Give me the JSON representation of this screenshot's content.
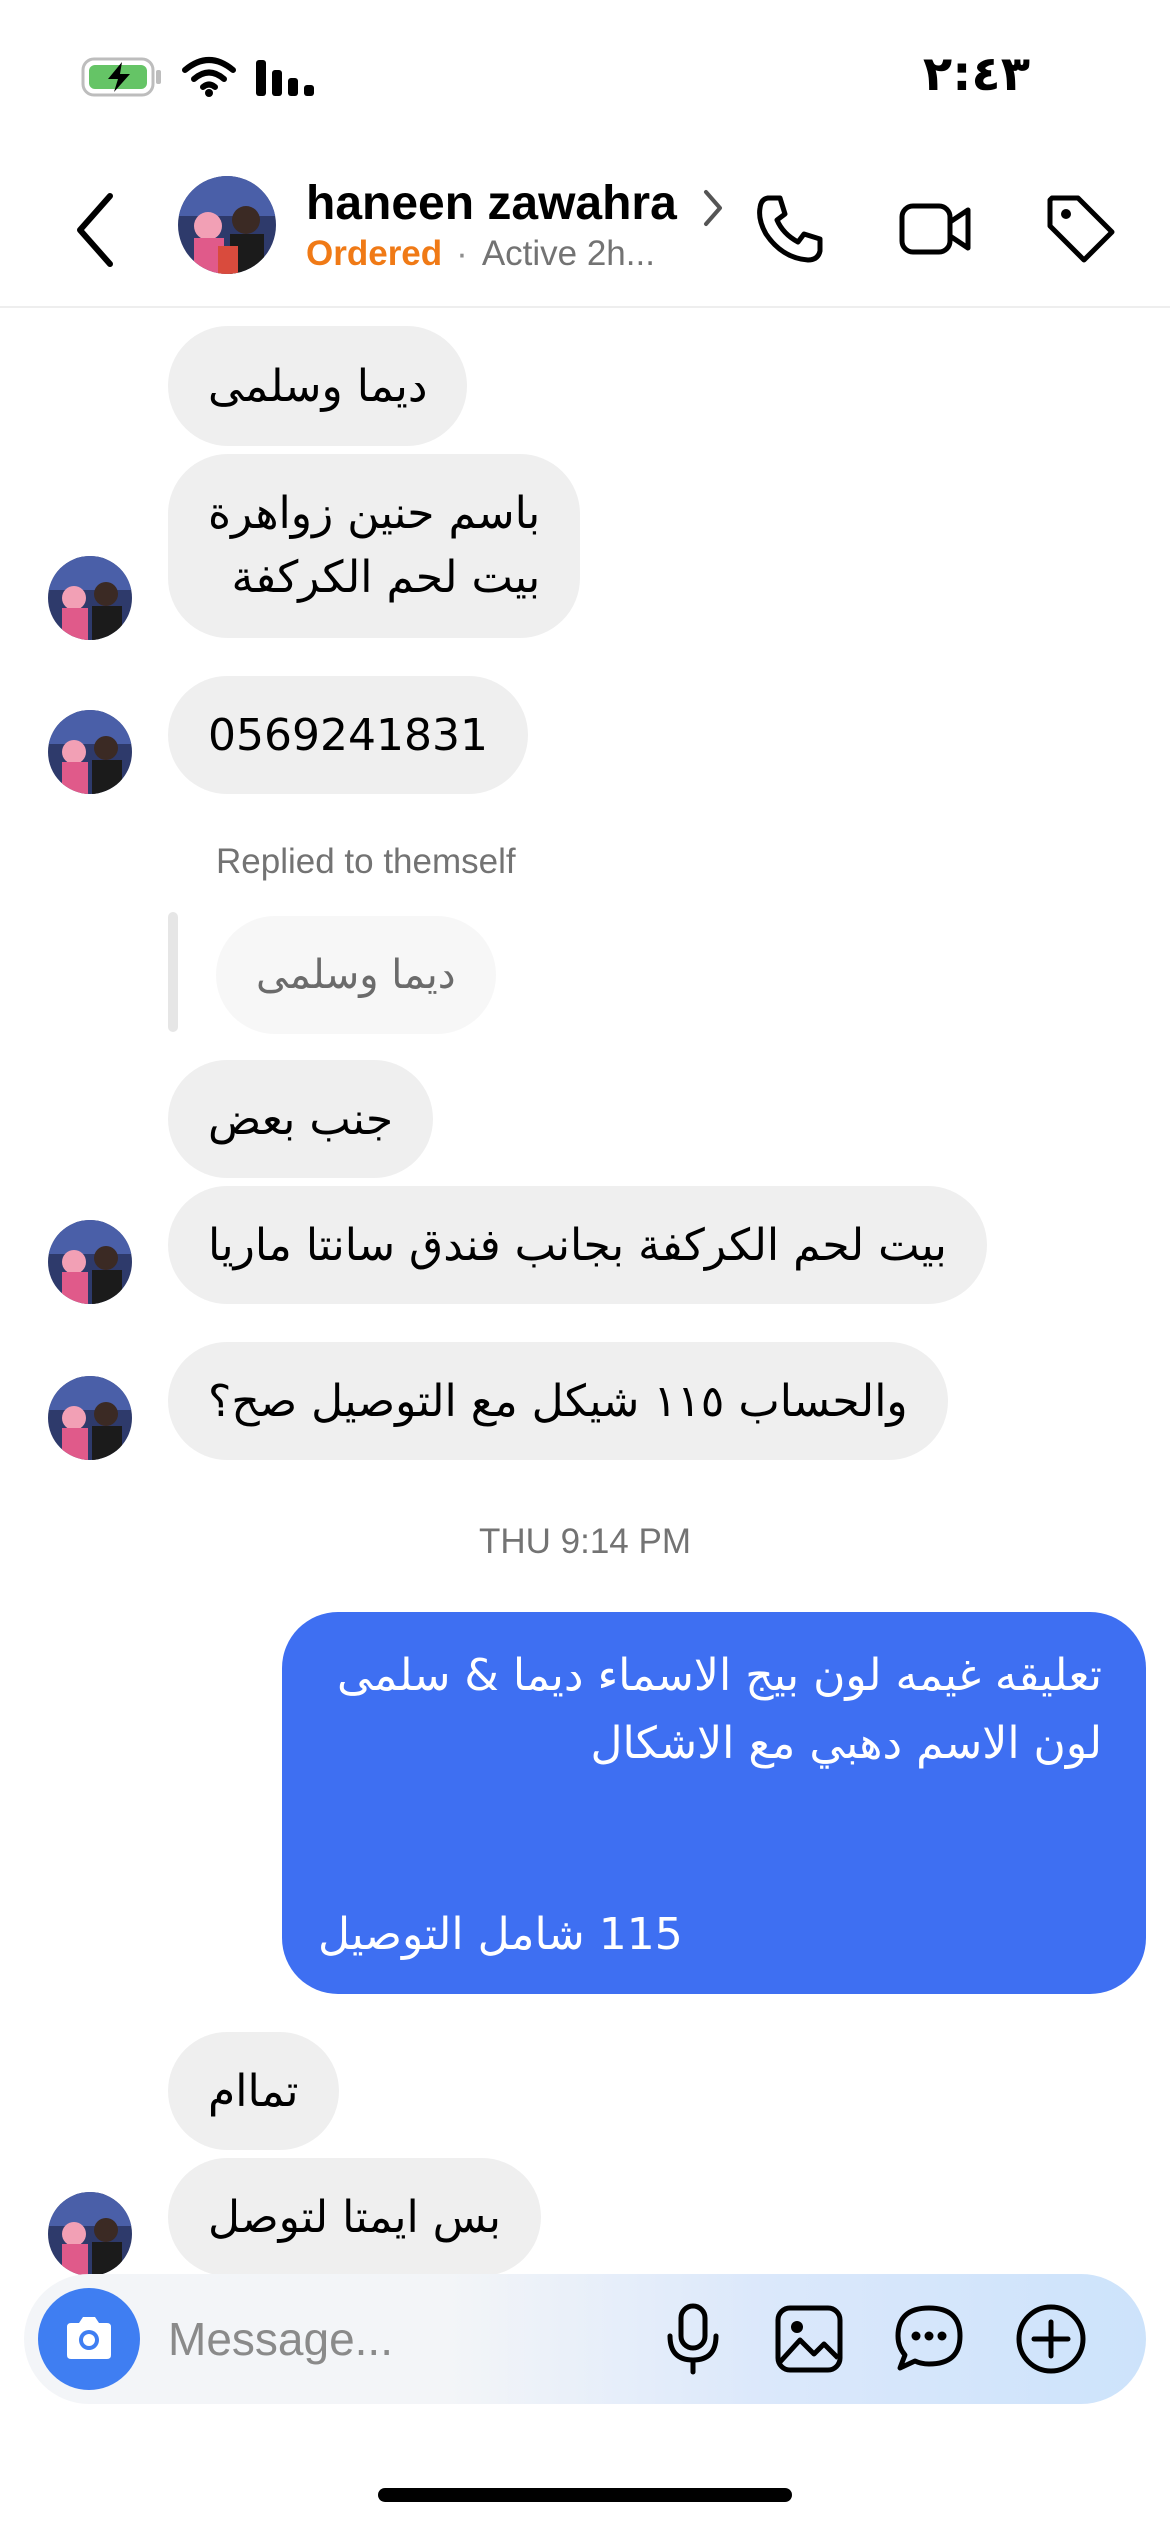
{
  "status_bar": {
    "time": "٢:٤٣"
  },
  "header": {
    "contact_name": "haneen zawahra",
    "status_label": "Ordered",
    "separator": "·",
    "activity": "Active 2h..."
  },
  "messages": {
    "m1": "ديما   وسلمى",
    "m2_line1": "باسم حنين زواهرة",
    "m2_line2": "بيت لحم الكركفة",
    "m3": "0569241831",
    "reply_note": "Replied to themself",
    "reply_quote": "ديما   وسلمى",
    "m4": "جنب بعض",
    "m5": "بيت لحم الكركفة بجانب فندق سانتا ماريا",
    "m6": "والحساب ١١٥ شيكل مع التوصيل صح؟",
    "timestamp": "THU 9:14 PM",
    "sent_line1": "تعليقه غيمه لون بيج الاسماء ديما & سلمى",
    "sent_line2": "لون الاسم دهبي مع الاشكال",
    "sent_line3": "115 شامل التوصيل",
    "m7": "تماام",
    "m8": "بس ايمتا لتوصل"
  },
  "composer": {
    "placeholder": "Message..."
  },
  "icons": {
    "back": "chevron-left-icon",
    "phone": "phone-icon",
    "video": "video-camera-icon",
    "tag": "tag-icon",
    "camera": "camera-icon",
    "mic": "microphone-icon",
    "gallery": "image-icon",
    "sticker": "chat-bubble-icon",
    "plus": "plus-circle-icon"
  },
  "colors": {
    "ordered": "#f07a16",
    "sent_bubble": "#3e6ff2",
    "received_bubble": "#efefef",
    "camera_button": "#3f7ef2",
    "battery_fill": "#65c466"
  }
}
